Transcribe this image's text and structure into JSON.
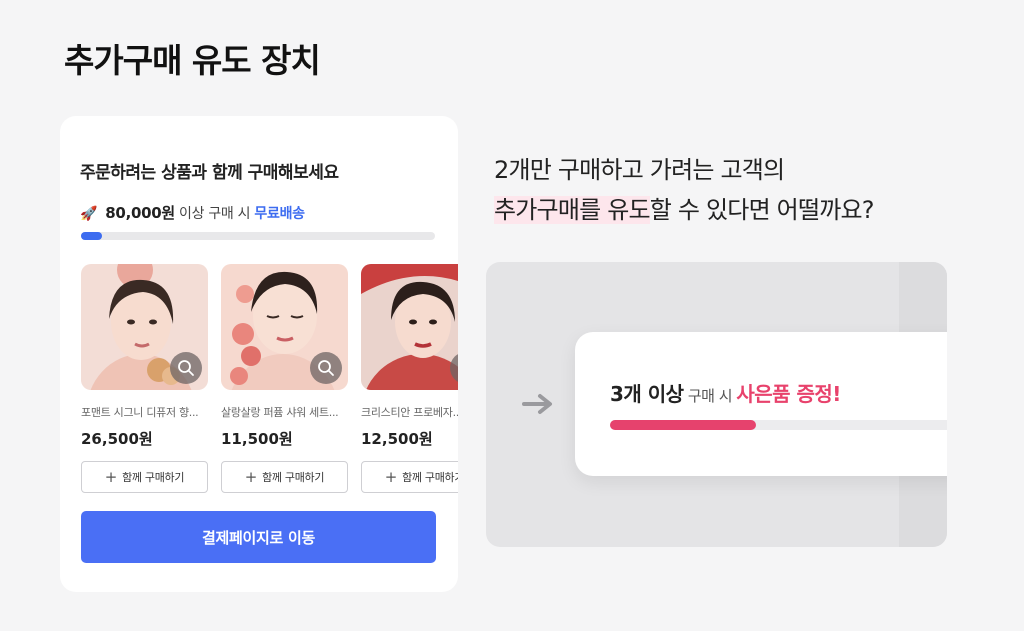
{
  "page": {
    "title": "추가구매 유도 장치"
  },
  "card": {
    "heading": "주문하려는 상품과 함께 구매해보세요",
    "threshold": {
      "icon": "rocket-icon",
      "amount": "80,000원",
      "condition": "이상 구매 시",
      "benefit": "무료배송"
    },
    "progress": 0.06,
    "products": [
      {
        "name": "포맨트 시그니 디퓨저 향...",
        "price": "26,500원",
        "add_label": "함께 구매하기",
        "image_icon": "product-photo-1",
        "zoom_icon": "search-icon"
      },
      {
        "name": "살랑살랑 퍼퓸 샤워 세트...",
        "price": "11,500원",
        "add_label": "함께 구매하기",
        "image_icon": "product-photo-2",
        "zoom_icon": "search-icon"
      },
      {
        "name": "크리스티안 프로베자...",
        "price": "12,500원",
        "add_label": "함께 구매하기",
        "image_icon": "product-photo-3",
        "zoom_icon": "search-icon"
      }
    ],
    "checkout_label": "결제페이지로 이동"
  },
  "copy": {
    "line1": "2개만 구매하고 가려는 고객의",
    "line2_highlight": "추가구매를 유도",
    "line2_rest": "할 수 있다면 어떨까요?"
  },
  "illustration": {
    "arrow_icon": "arrow-right-icon",
    "count_text": "3개 이상",
    "condition_text": "구매 시",
    "gift_text": "사은품 증정!",
    "progress": 0.38
  },
  "colors": {
    "accent_blue": "#4a6ff5",
    "accent_pink": "#e6426d",
    "highlight": "#fde6ec"
  }
}
